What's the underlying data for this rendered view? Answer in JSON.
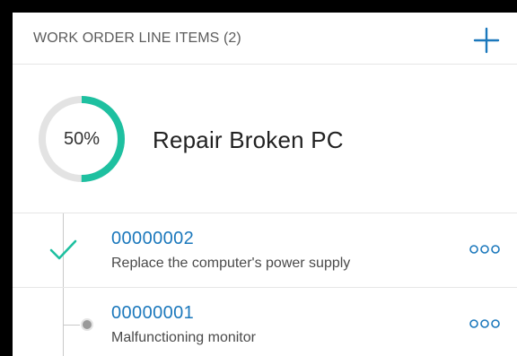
{
  "header": {
    "title": "WORK ORDER LINE ITEMS (2)",
    "add_icon": "plus-icon"
  },
  "summary": {
    "progress_text": "50%",
    "progress_fraction": 0.5,
    "subject": "Repair Broken PC"
  },
  "line_items": [
    {
      "number": "00000002",
      "description": "Replace the computer's power supply",
      "status_icon": "checkmark-icon",
      "more_icon": "more-options-icon"
    },
    {
      "number": "00000001",
      "description": "Malfunctioning monitor",
      "status_icon": "dot-icon",
      "more_icon": "more-options-icon"
    }
  ],
  "colors": {
    "accent_teal": "#1ec0a0",
    "link_blue": "#1b78bc",
    "ring_track": "#e3e3e3",
    "line_gray": "#c9c9c9"
  }
}
